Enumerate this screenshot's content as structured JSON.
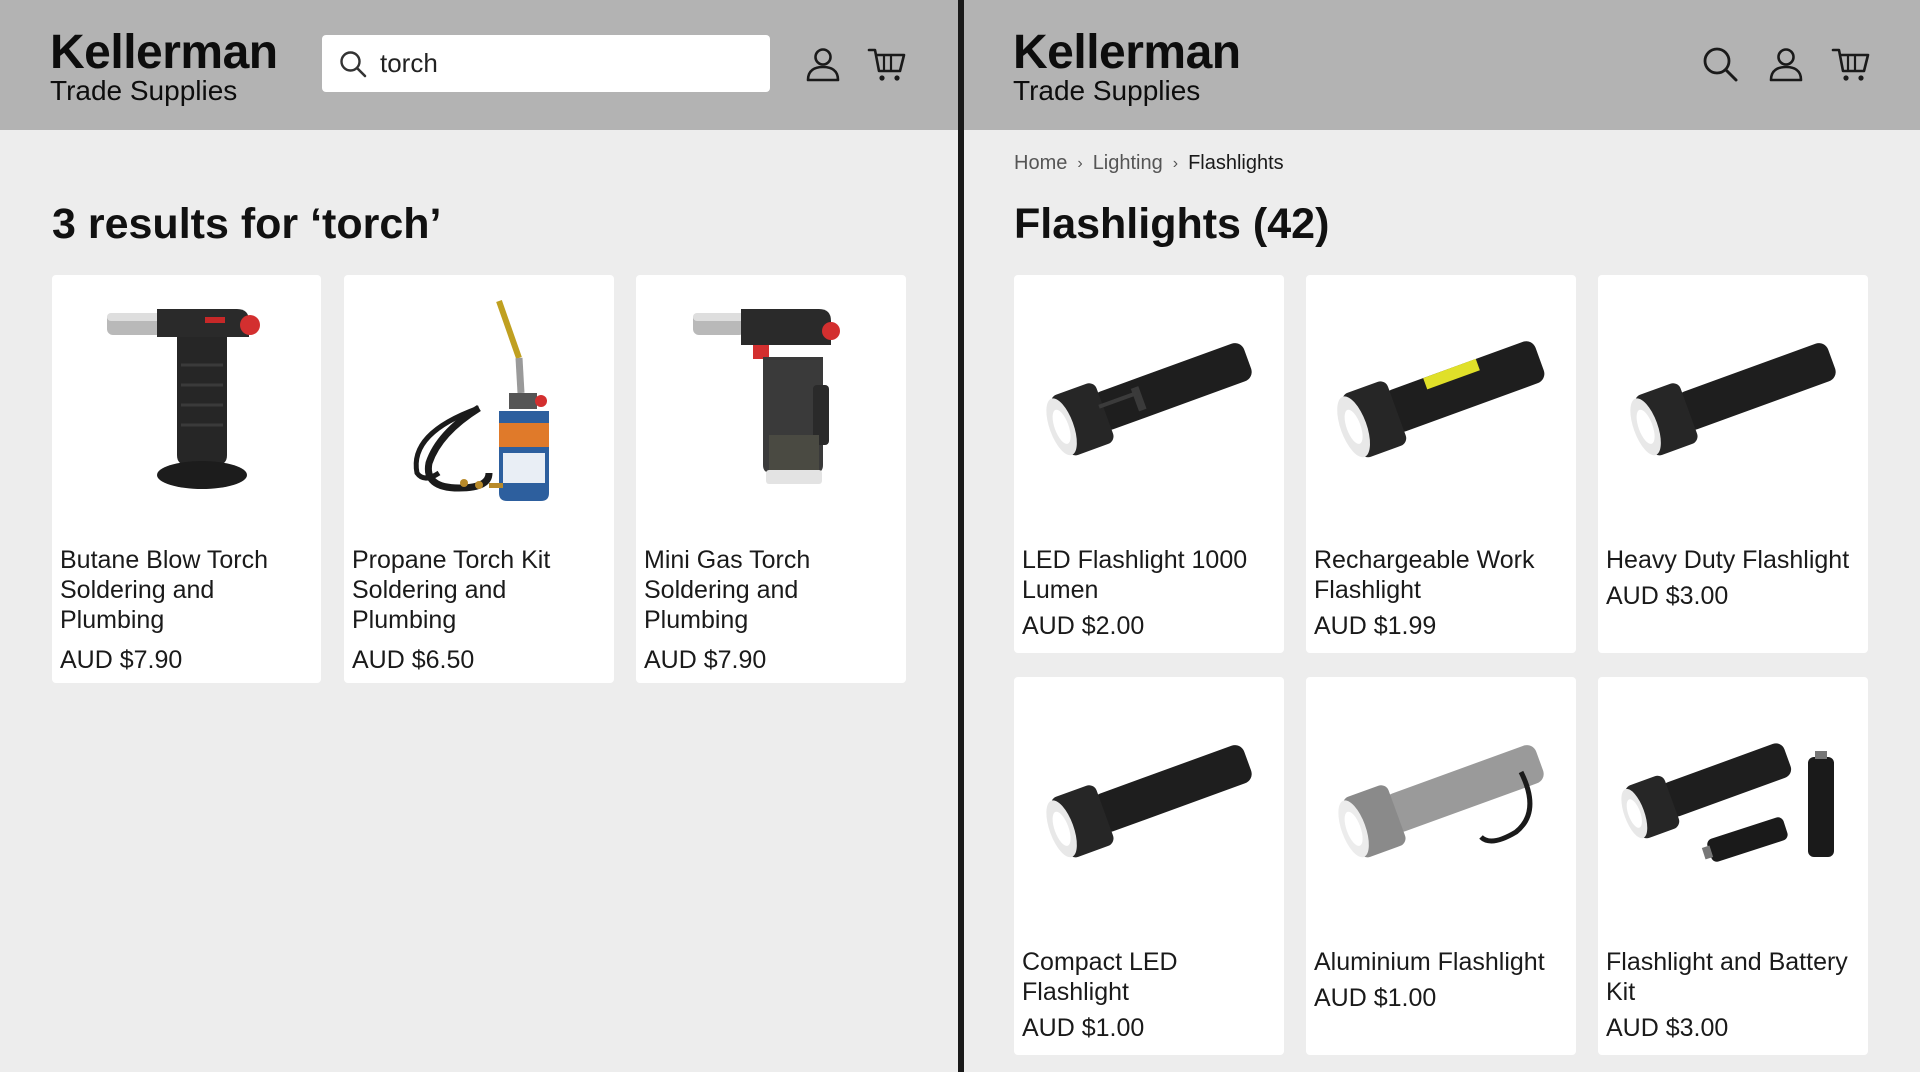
{
  "left": {
    "brand": {
      "name": "Kellerman",
      "subtitle": "Trade Supplies"
    },
    "search": {
      "value": "torch"
    },
    "results_title": "3 results for ‘torch’",
    "products": [
      {
        "name": "Butane Blow Torch Soldering and Plumbing",
        "price": "AUD $7.90",
        "icon": "blow-torch"
      },
      {
        "name": "Propane Torch Kit Soldering and Plumbing",
        "price": "AUD $6.50",
        "icon": "propane-torch-kit"
      },
      {
        "name": "Mini Gas Torch Soldering and Plumbing",
        "price": "AUD $7.90",
        "icon": "mini-gas-torch"
      }
    ]
  },
  "right": {
    "brand": {
      "name": "Kellerman",
      "subtitle": "Trade Supplies"
    },
    "breadcrumb": [
      "Home",
      "Lighting",
      "Flashlights"
    ],
    "category_title": "Flashlights (42)",
    "products": [
      {
        "name": "LED Flashlight 1000 Lumen",
        "price": "AUD $2.00",
        "icon": "flashlight"
      },
      {
        "name": "Rechargeable Work Flashlight",
        "price": "AUD $1.99",
        "icon": "flashlight-yellow-strip"
      },
      {
        "name": "Heavy Duty Flashlight",
        "price": "AUD $3.00",
        "icon": "flashlight"
      },
      {
        "name": "Compact LED Flashlight",
        "price": "AUD $1.00",
        "icon": "flashlight"
      },
      {
        "name": "Aluminium Flashlight",
        "price": "AUD $1.00",
        "icon": "flashlight-silver"
      },
      {
        "name": "Flashlight and Battery Kit",
        "price": "AUD $3.00",
        "icon": "flashlight-battery-kit"
      }
    ]
  },
  "colors": {
    "header_bg": "#b3b3b3",
    "page_bg": "#ededed",
    "card_bg": "#ffffff",
    "divider": "#1a1a1a"
  }
}
